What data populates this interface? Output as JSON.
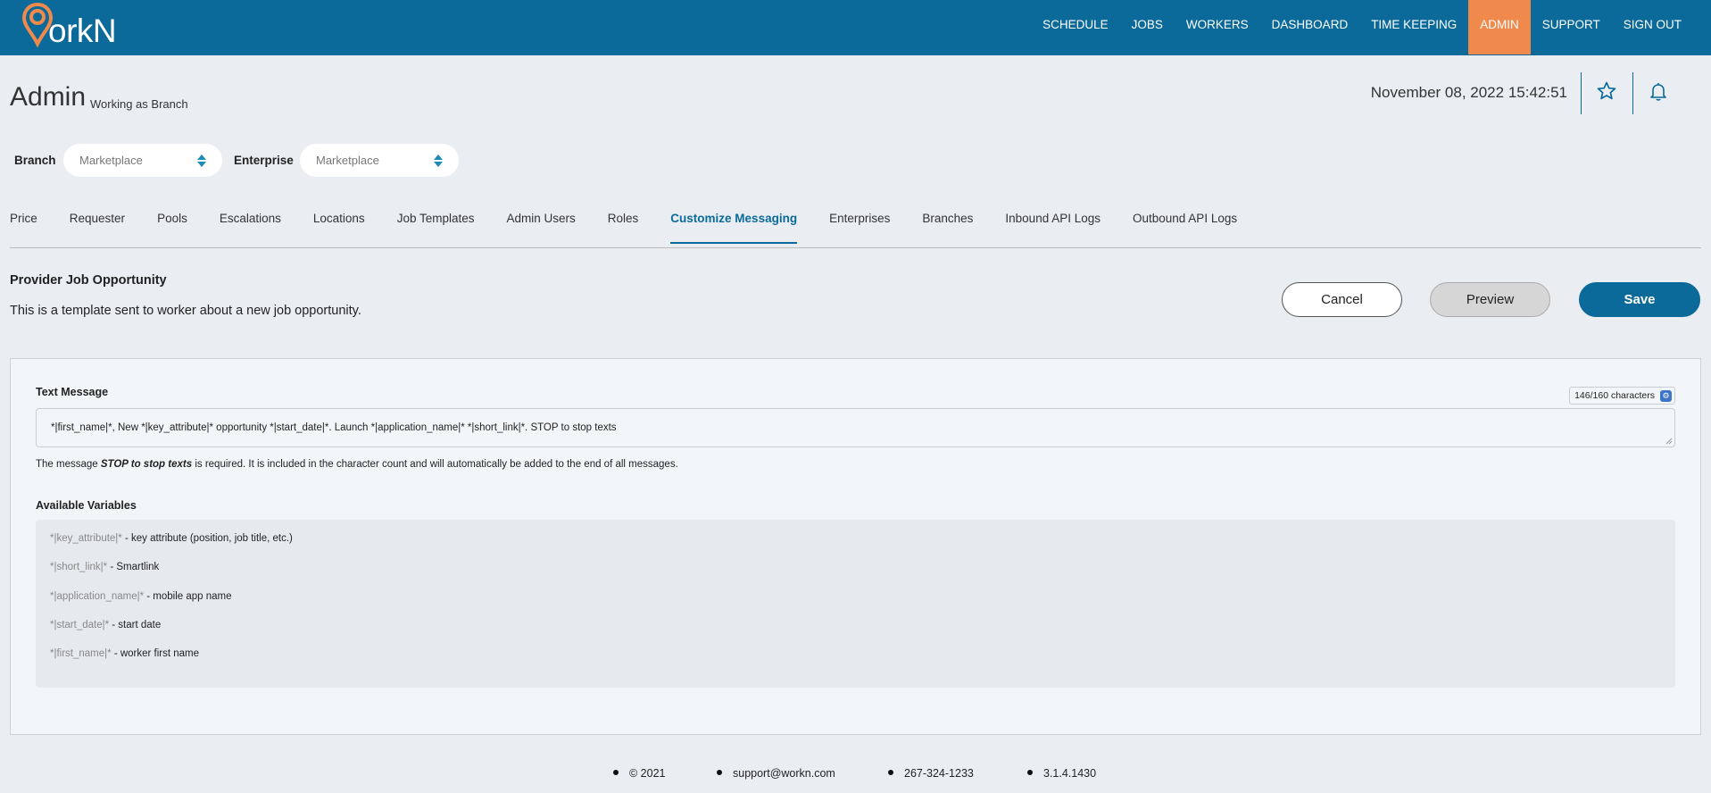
{
  "app": {
    "logo_text": "orkN"
  },
  "nav": {
    "items": [
      "SCHEDULE",
      "JOBS",
      "WORKERS",
      "DASHBOARD",
      "TIME KEEPING",
      "ADMIN",
      "SUPPORT",
      "SIGN OUT"
    ],
    "active": "ADMIN"
  },
  "header": {
    "title": "Admin",
    "subtitle": "Working as Branch",
    "datetime": "November 08, 2022 15:42:51",
    "icons": [
      "star-icon",
      "bell-icon"
    ]
  },
  "filters": {
    "branch": {
      "label": "Branch",
      "value": "Marketplace"
    },
    "enterprise": {
      "label": "Enterprise",
      "value": "Marketplace"
    }
  },
  "tabs": {
    "items": [
      "Price",
      "Requester",
      "Pools",
      "Escalations",
      "Locations",
      "Job Templates",
      "Admin Users",
      "Roles",
      "Customize Messaging",
      "Enterprises",
      "Branches",
      "Inbound API Logs",
      "Outbound API Logs"
    ],
    "active": "Customize Messaging"
  },
  "section": {
    "title": "Provider Job Opportunity",
    "description": "This is a template sent to worker about a new job opportunity.",
    "cancel_label": "Cancel",
    "preview_label": "Preview",
    "save_label": "Save"
  },
  "text_message": {
    "label": "Text Message",
    "char_count": "146/160 characters",
    "value": "*|first_name|*, New *|key_attribute|* opportunity *|start_date|*. Launch *|application_name|* *|short_link|*. STOP to stop texts",
    "notice_prefix": "The message ",
    "notice_bold": "STOP to stop texts",
    "notice_suffix": " is required. It is included in the character count and will automatically be added to the end of all messages."
  },
  "variables": {
    "label": "Available Variables",
    "items": [
      {
        "code": "*|key_attribute|*",
        "desc": " - key attribute (position, job title, etc.)"
      },
      {
        "code": "*|short_link|*",
        "desc": " - Smartlink"
      },
      {
        "code": "*|application_name|*",
        "desc": " - mobile app name"
      },
      {
        "code": "*|start_date|*",
        "desc": " - start date"
      },
      {
        "code": "*|first_name|*",
        "desc": " - worker first name"
      }
    ]
  },
  "footer": {
    "copyright": "© 2021",
    "email": "support@workn.com",
    "phone": "267-324-1233",
    "version": "3.1.4.1430"
  },
  "colors": {
    "primary": "#0b6a9a",
    "accent": "#ef8a4c",
    "background": "#eaeef2"
  }
}
